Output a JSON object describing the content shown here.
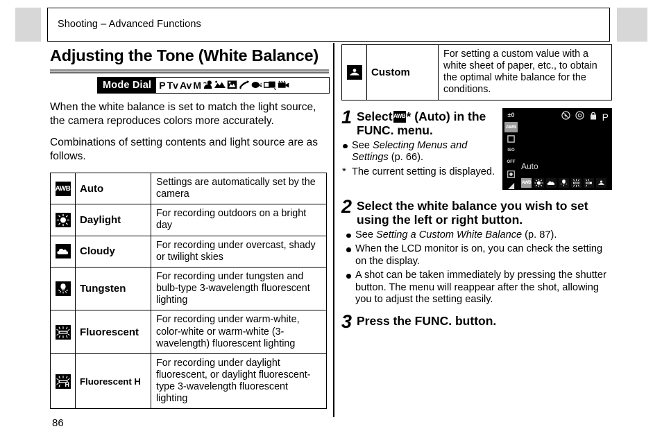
{
  "page": {
    "running_header": "Shooting – Advanced Functions",
    "page_number": "86",
    "section_title": "Adjusting the Tone (White Balance)"
  },
  "mode_dial": {
    "label": "Mode Dial",
    "modes": [
      "P",
      "Tv",
      "Av",
      "M"
    ],
    "icons": [
      "portrait-mode-icon",
      "landscape-mode-icon",
      "night-scene-mode-icon",
      "fast-shutter-mode-icon",
      "slow-shutter-mode-icon",
      "stitch-assist-mode-icon",
      "movie-mode-icon"
    ]
  },
  "intro": {
    "paragraph1": "When the white balance is set to match the light source, the camera reproduces colors more accurately.",
    "paragraph2": "Combinations of setting contents and light source are as follows."
  },
  "wb_table": {
    "rows": [
      {
        "icon": "awb-icon",
        "icon_text": "AWB",
        "name": "Auto",
        "description": "Settings are automatically set by the camera"
      },
      {
        "icon": "daylight-sun-icon",
        "icon_text": "",
        "name": "Daylight",
        "description": "For recording outdoors on a bright day"
      },
      {
        "icon": "cloudy-icon",
        "icon_text": "",
        "name": "Cloudy",
        "description": "For recording under overcast, shady or twilight skies"
      },
      {
        "icon": "tungsten-icon",
        "icon_text": "",
        "name": "Tungsten",
        "description": "For recording under tungsten and bulb-type 3-wavelength fluorescent lighting"
      },
      {
        "icon": "fluorescent-icon",
        "icon_text": "",
        "name": "Fluorescent",
        "description": "For recording under warm-white, color-white or warm-white (3-wavelength) fluorescent lighting"
      },
      {
        "icon": "fluorescent-h-icon",
        "icon_text": "H",
        "name": "Fluorescent H",
        "description": "For recording under daylight fluorescent, or daylight fluorescent-type 3-wavelength fluorescent lighting"
      }
    ],
    "custom_row": {
      "icon": "custom-wb-icon",
      "name": "Custom",
      "description": "For setting a custom value with a white sheet of paper, etc., to obtain the optimal white balance for the conditions."
    }
  },
  "steps": [
    {
      "number": "1",
      "title_before": "Select",
      "title_after": "* (Auto) in the FUNC. menu.",
      "bullets": [
        {
          "kind": "dot",
          "text_plain": "See ",
          "text_italic": "Selecting Menus and Settings",
          "text_tail": " (p. 66)."
        },
        {
          "kind": "star",
          "text_plain": "The current setting is displayed.",
          "text_italic": "",
          "text_tail": ""
        }
      ]
    },
    {
      "number": "2",
      "title_before": "Select the white balance you wish to set using the left or right button.",
      "title_after": "",
      "bullets": [
        {
          "kind": "dot",
          "text_plain": "See ",
          "text_italic": "Setting a Custom White Balance",
          "text_tail": " (p. 87)."
        },
        {
          "kind": "dot",
          "text_plain": "When the LCD monitor is on, you can check the setting on the display.",
          "text_italic": "",
          "text_tail": ""
        },
        {
          "kind": "dot",
          "text_plain": "A shot can be taken immediately by pressing the shutter button. The menu will reappear after the shot, allowing you to adjust the setting easily.",
          "text_italic": "",
          "text_tail": ""
        }
      ]
    },
    {
      "number": "3",
      "title_before": "Press the FUNC. button.",
      "title_after": "",
      "bullets": []
    }
  ],
  "lcd_screen": {
    "shooting_mode": "P",
    "selected_label": "Auto",
    "side_items": [
      {
        "name": "exposure-compensation-icon",
        "text": "±0",
        "selected": false
      },
      {
        "name": "white-balance-icon",
        "text": "AWB",
        "selected": true
      },
      {
        "name": "drive-mode-single-icon",
        "text": "",
        "selected": false
      },
      {
        "name": "iso-speed-icon",
        "text": "ISO",
        "selected": false
      },
      {
        "name": "flash-exposure-off-icon",
        "text": "OFF",
        "selected": false
      },
      {
        "name": "photo-effect-icon",
        "text": "",
        "selected": false
      },
      {
        "name": "image-quality-superfine-icon",
        "text": "",
        "selected": false
      }
    ],
    "top_right_icons": [
      "flash-off-icon",
      "metering-icon",
      "macro-icon"
    ],
    "wb_strip": [
      {
        "name": "awb-strip-icon",
        "text": "AWB",
        "highlighted": true
      },
      {
        "name": "daylight-strip-icon",
        "text": "",
        "highlighted": false
      },
      {
        "name": "cloudy-strip-icon",
        "text": "",
        "highlighted": false
      },
      {
        "name": "tungsten-strip-icon",
        "text": "",
        "highlighted": false
      },
      {
        "name": "fluorescent-strip-icon",
        "text": "",
        "highlighted": false
      },
      {
        "name": "fluorescent-h-strip-icon",
        "text": "H",
        "highlighted": false
      },
      {
        "name": "custom-strip-icon",
        "text": "",
        "highlighted": false
      }
    ]
  },
  "colors": {
    "tab_gray": "#d7d7d7",
    "rule_gray": "#8c8c8c",
    "ink": "#000000",
    "lcd_bg": "#000000",
    "lcd_highlight": "#9d9d9d"
  }
}
